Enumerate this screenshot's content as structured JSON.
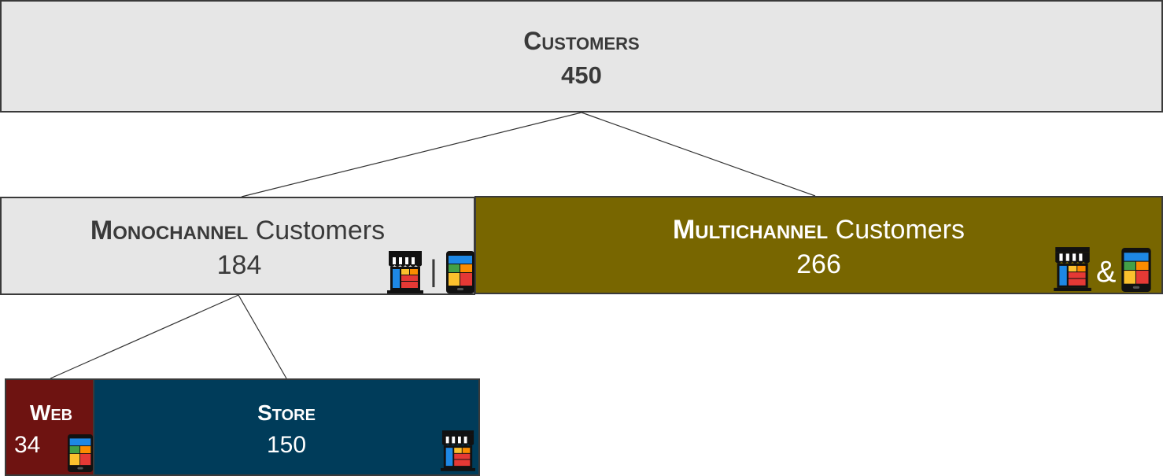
{
  "root": {
    "title": "Customers",
    "count": "450"
  },
  "monochannel": {
    "title_bold": "Monochannel",
    "title_rest": " Customers",
    "count": "184",
    "separator": "|"
  },
  "multichannel": {
    "title_bold": "Multichannel",
    "title_rest": " Customers",
    "count": "266",
    "separator": "&"
  },
  "web": {
    "title": "Web",
    "count": "34"
  },
  "store": {
    "title": "Store",
    "count": "150"
  },
  "icons": [
    "store-icon",
    "smartphone-icon"
  ],
  "colors": {
    "neutral_box": "#e6e6e6",
    "multichannel": "#786600",
    "web": "#6e1311",
    "store": "#003c5a",
    "text_dark": "#3a3a3a"
  }
}
